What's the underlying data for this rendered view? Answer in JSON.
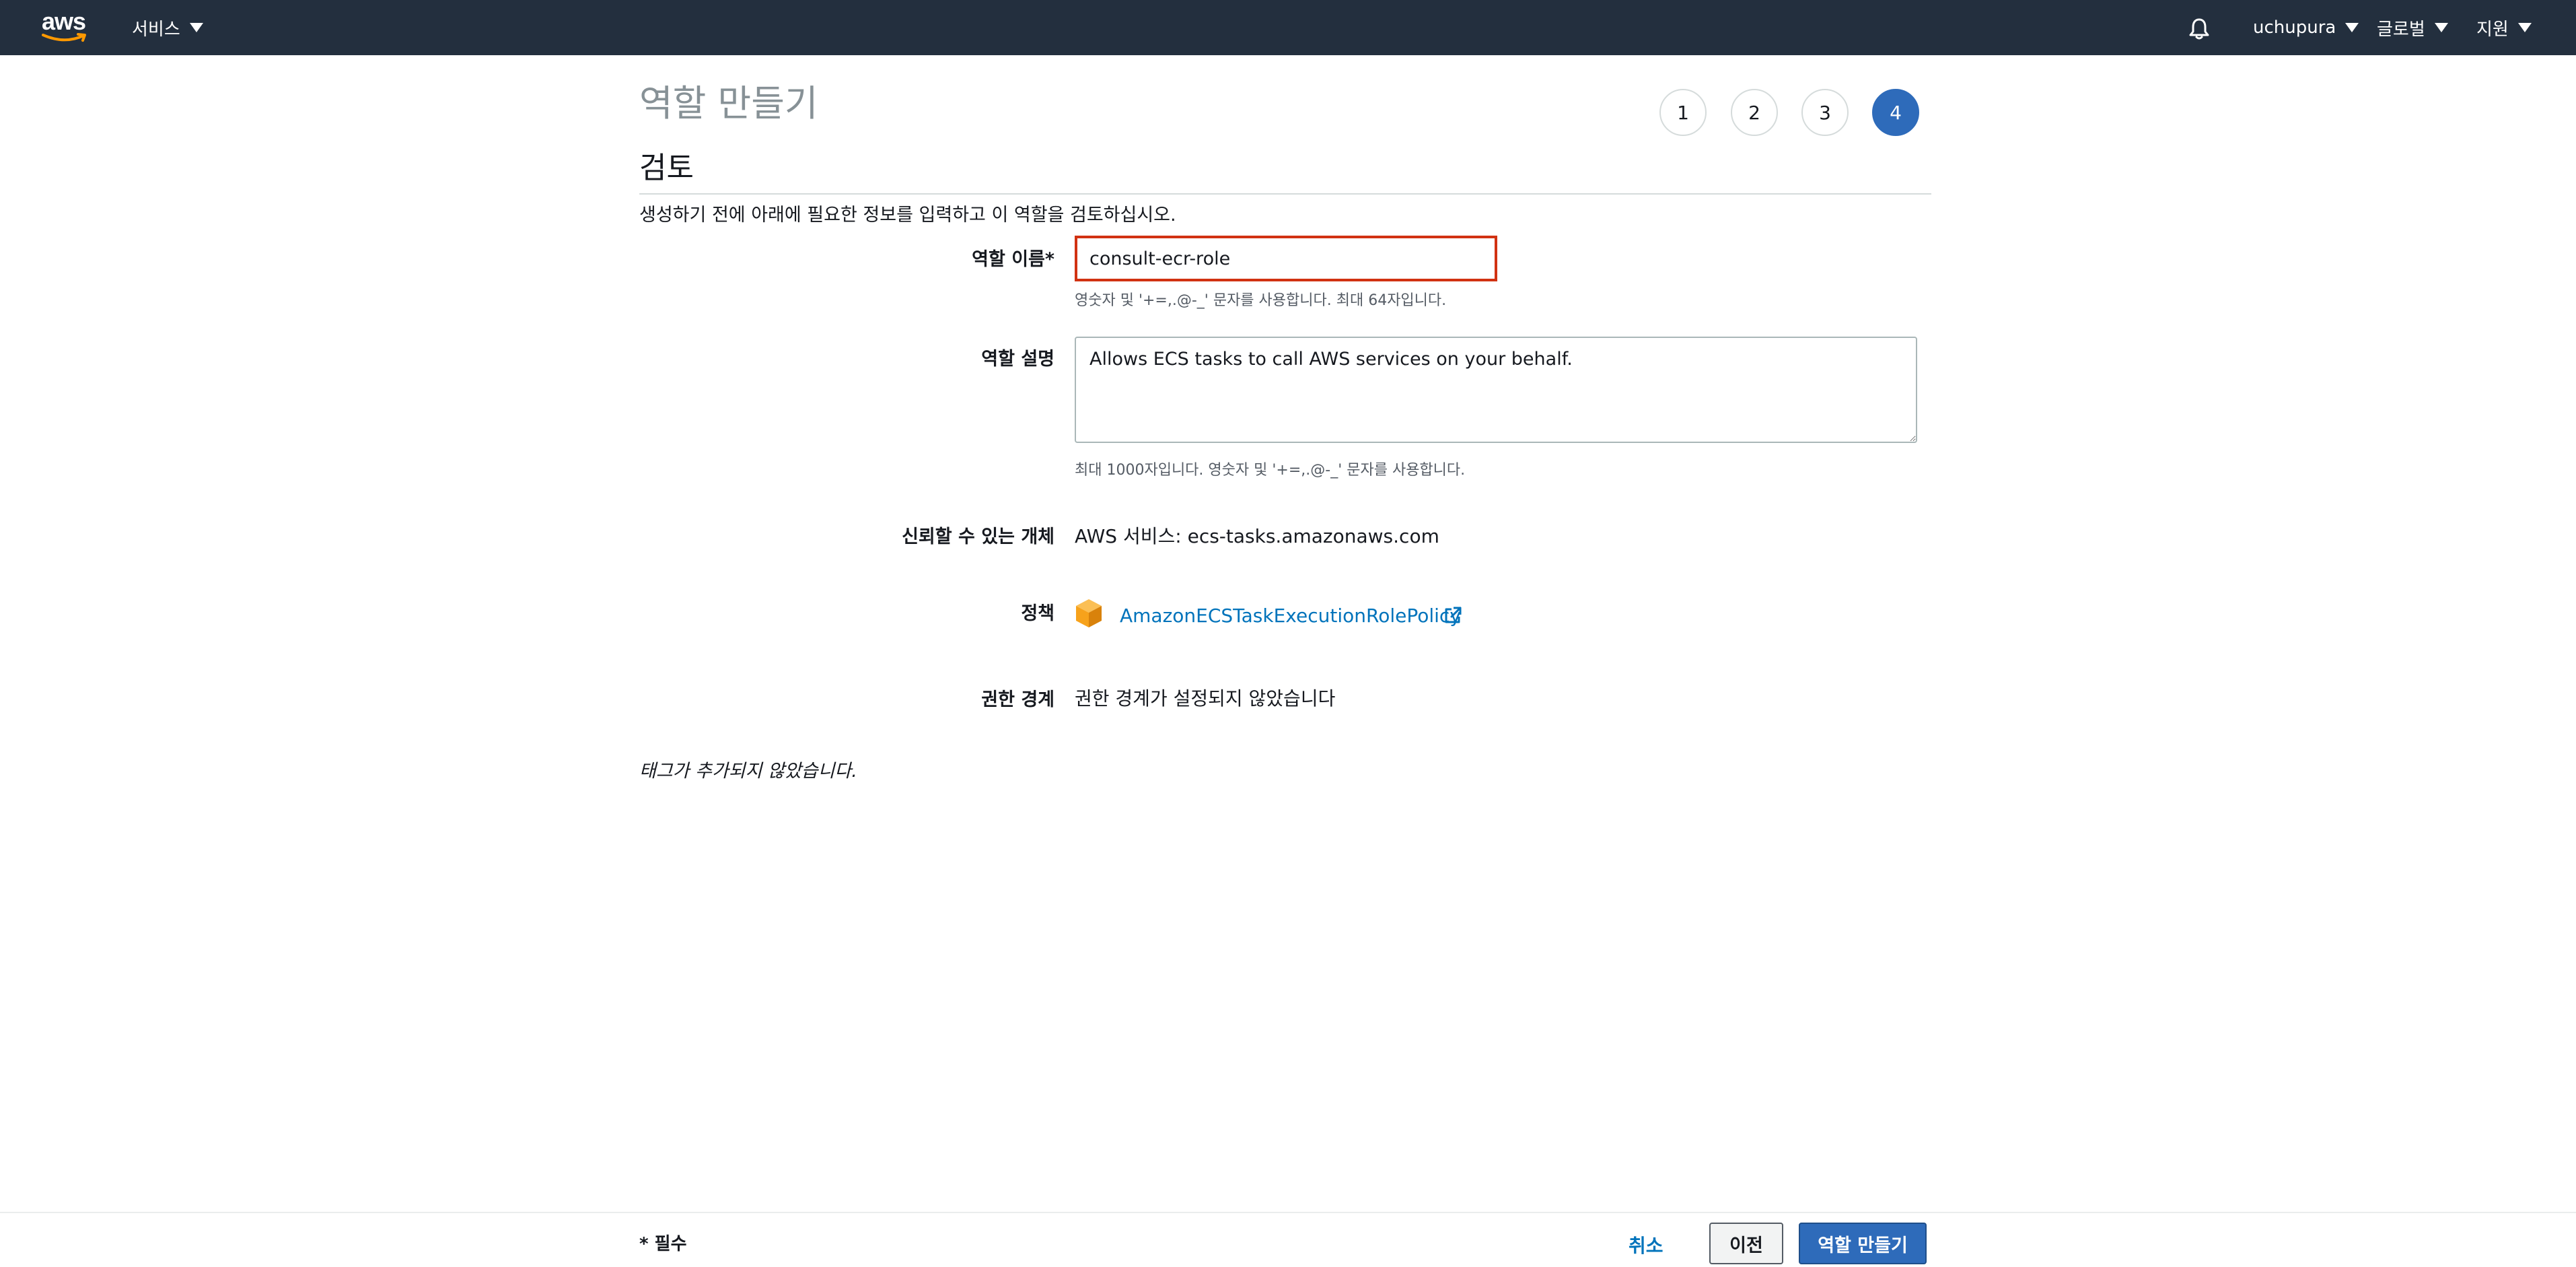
{
  "topnav": {
    "logo_text": "aws",
    "services_label": "서비스",
    "notifications_icon": "bell-icon",
    "user_label": "uchupura",
    "region_label": "글로벌",
    "support_label": "지원"
  },
  "page": {
    "title": "역할 만들기",
    "steps": [
      "1",
      "2",
      "3",
      "4"
    ],
    "active_step": "4",
    "section_title": "검토",
    "intro": "생성하기 전에 아래에 필요한 정보를 입력하고 이 역할을 검토하십시오."
  },
  "form": {
    "role_name_label": "역할 이름*",
    "role_name_value": "consult-ecr-role",
    "role_name_hint": "영숫자 및 '+=,.@-_' 문자를 사용합니다. 최대 64자입니다.",
    "role_desc_label": "역할 설명",
    "role_desc_value": "Allows ECS tasks to call AWS services on your behalf.",
    "role_desc_hint": "최대 1000자입니다. 영숫자 및 '+=,.@-_' 문자를 사용합니다.",
    "trusted_label": "신뢰할 수 있는 개체",
    "trusted_value": "AWS 서비스: ecs-tasks.amazonaws.com",
    "policy_label": "정책",
    "policy_icon": "package-box-icon",
    "policy_link": "AmazonECSTaskExecutionRolePolicy",
    "boundary_label": "권한 경계",
    "boundary_value": "권한 경계가 설정되지 않았습니다",
    "no_tags": "태그가 추가되지 않았습니다."
  },
  "footer": {
    "required_note": "* 필수",
    "cancel_label": "취소",
    "previous_label": "이전",
    "create_label": "역할 만들기"
  },
  "colors": {
    "nav_bg": "#232f3e",
    "primary": "#2e6bba",
    "link": "#0073bb",
    "error_border": "#d13212",
    "policy_icon": "#f7a21b"
  }
}
